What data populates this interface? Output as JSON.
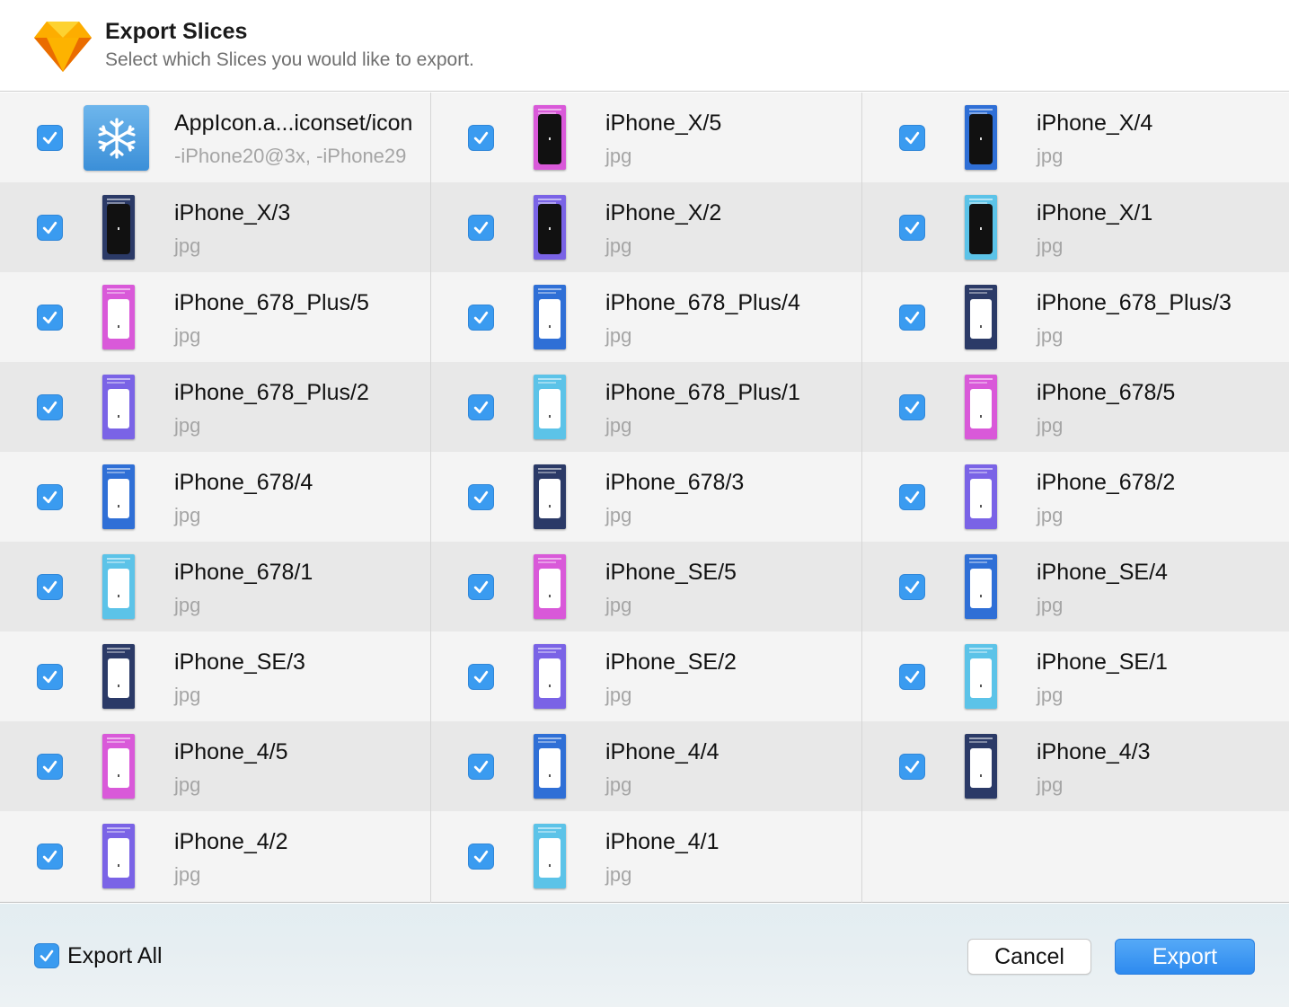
{
  "dialog": {
    "title": "Export Slices",
    "subtitle": "Select which Slices you would like to export."
  },
  "colors": {
    "accent": "#3A9BF0",
    "thumb_navy": "#2B3A67",
    "thumb_blue": "#2F6FD6",
    "thumb_magenta": "#D959D9",
    "thumb_violet": "#7A63E6",
    "thumb_cyan": "#5CC3E8"
  },
  "columns": [
    [
      {
        "name": "AppIcon.a...iconset/icon",
        "ext": "-iPhone20@3x, -iPhone29",
        "checked": true,
        "thumb": "appicon",
        "icon": "snowflake-icon"
      },
      {
        "name": "iPhone_X/3",
        "ext": "jpg",
        "checked": true,
        "thumb": "x",
        "color": "#2B3A67"
      },
      {
        "name": "iPhone_678_Plus/5",
        "ext": "jpg",
        "checked": true,
        "thumb": "w",
        "color": "#D959D9"
      },
      {
        "name": "iPhone_678_Plus/2",
        "ext": "jpg",
        "checked": true,
        "thumb": "w",
        "color": "#7A63E6"
      },
      {
        "name": "iPhone_678/4",
        "ext": "jpg",
        "checked": true,
        "thumb": "w",
        "color": "#2F6FD6"
      },
      {
        "name": "iPhone_678/1",
        "ext": "jpg",
        "checked": true,
        "thumb": "w",
        "color": "#5CC3E8"
      },
      {
        "name": "iPhone_SE/3",
        "ext": "jpg",
        "checked": true,
        "thumb": "w",
        "color": "#2B3A67"
      },
      {
        "name": "iPhone_4/5",
        "ext": "jpg",
        "checked": true,
        "thumb": "w",
        "color": "#D959D9"
      },
      {
        "name": "iPhone_4/2",
        "ext": "jpg",
        "checked": true,
        "thumb": "w",
        "color": "#7A63E6"
      }
    ],
    [
      {
        "name": "iPhone_X/5",
        "ext": "jpg",
        "checked": true,
        "thumb": "x",
        "color": "#D959D9"
      },
      {
        "name": "iPhone_X/2",
        "ext": "jpg",
        "checked": true,
        "thumb": "x",
        "color": "#7A63E6"
      },
      {
        "name": "iPhone_678_Plus/4",
        "ext": "jpg",
        "checked": true,
        "thumb": "w",
        "color": "#2F6FD6"
      },
      {
        "name": "iPhone_678_Plus/1",
        "ext": "jpg",
        "checked": true,
        "thumb": "w",
        "color": "#5CC3E8"
      },
      {
        "name": "iPhone_678/3",
        "ext": "jpg",
        "checked": true,
        "thumb": "w",
        "color": "#2B3A67"
      },
      {
        "name": "iPhone_SE/5",
        "ext": "jpg",
        "checked": true,
        "thumb": "w",
        "color": "#D959D9"
      },
      {
        "name": "iPhone_SE/2",
        "ext": "jpg",
        "checked": true,
        "thumb": "w",
        "color": "#7A63E6"
      },
      {
        "name": "iPhone_4/4",
        "ext": "jpg",
        "checked": true,
        "thumb": "w",
        "color": "#2F6FD6"
      },
      {
        "name": "iPhone_4/1",
        "ext": "jpg",
        "checked": true,
        "thumb": "w",
        "color": "#5CC3E8"
      }
    ],
    [
      {
        "name": "iPhone_X/4",
        "ext": "jpg",
        "checked": true,
        "thumb": "x",
        "color": "#2F6FD6"
      },
      {
        "name": "iPhone_X/1",
        "ext": "jpg",
        "checked": true,
        "thumb": "x",
        "color": "#5CC3E8"
      },
      {
        "name": "iPhone_678_Plus/3",
        "ext": "jpg",
        "checked": true,
        "thumb": "w",
        "color": "#2B3A67"
      },
      {
        "name": "iPhone_678/5",
        "ext": "jpg",
        "checked": true,
        "thumb": "w",
        "color": "#D959D9"
      },
      {
        "name": "iPhone_678/2",
        "ext": "jpg",
        "checked": true,
        "thumb": "w",
        "color": "#7A63E6"
      },
      {
        "name": "iPhone_SE/4",
        "ext": "jpg",
        "checked": true,
        "thumb": "w",
        "color": "#2F6FD6"
      },
      {
        "name": "iPhone_SE/1",
        "ext": "jpg",
        "checked": true,
        "thumb": "w",
        "color": "#5CC3E8"
      },
      {
        "name": "iPhone_4/3",
        "ext": "jpg",
        "checked": true,
        "thumb": "w",
        "color": "#2B3A67"
      }
    ]
  ],
  "footer": {
    "export_all_label": "Export All",
    "export_all_checked": true,
    "cancel_label": "Cancel",
    "export_label": "Export"
  }
}
